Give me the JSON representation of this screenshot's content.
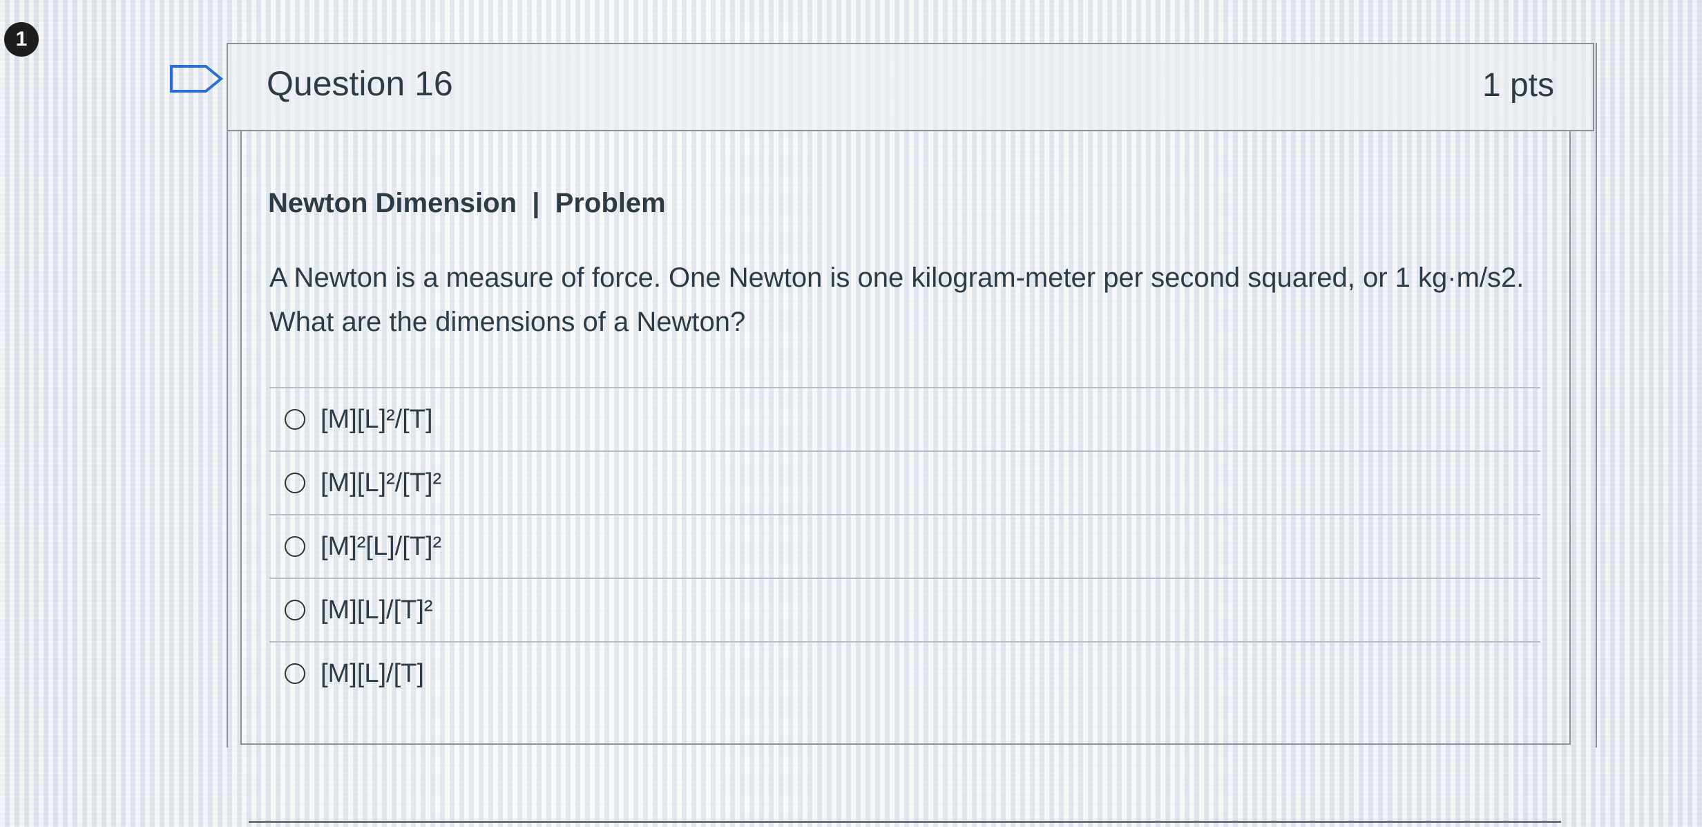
{
  "badge": {
    "number": "1"
  },
  "question": {
    "title": "Question 16",
    "points": "1 pts",
    "heading": "Newton Dimension  |  Problem",
    "text": "A Newton is a measure of force.  One Newton is one kilogram-meter per second squared, or 1 kg·m/s2.  What are the dimensions of a Newton?"
  },
  "answers": [
    {
      "label": "[M][L]²/[T]"
    },
    {
      "label": "[M][L]²/[T]²"
    },
    {
      "label": "[M]²[L]/[T]²"
    },
    {
      "label": "[M][L]/[T]²"
    },
    {
      "label": "[M][L]/[T]"
    }
  ],
  "icons": {
    "badge": "step-number-badge",
    "flag": "flag-question-icon",
    "radio": "radio-button-icon"
  }
}
